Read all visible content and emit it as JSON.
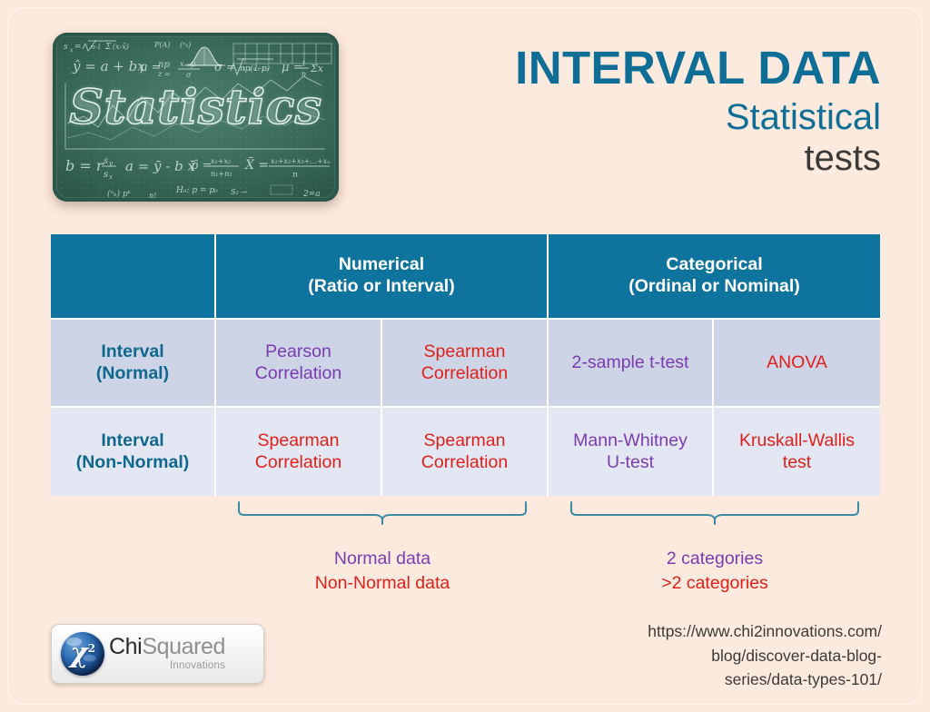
{
  "page": {
    "background_color": "#fdeade",
    "accent_teal": "#0f6e96",
    "accent_purple": "#7a3cb0",
    "accent_red": "#e0201a"
  },
  "header": {
    "title": "INTERVAL DATA",
    "subtitle_line1": "Statistical",
    "subtitle_line2": "tests"
  },
  "chalkboard": {
    "word": "Statistics",
    "formulas": [
      "s_x = √( 1/(n-1) Σ(x_i - x̄)² )",
      "ŷ = a + bx",
      "μ = np",
      "z = (x - μ)/σ",
      "σ = √(np(1-p))",
      "μ = (1/n)Σx_i",
      "b = r·s_y/s_x",
      "a = ȳ - b·x̄",
      "p̂ = (x₁+x₂)/(n₁+n₂)",
      "X̄ = (x₁+x₂+x₃+...+x_n)/n",
      "H₀: p = p₀"
    ]
  },
  "table": {
    "columns_header": [
      "",
      "Numerical\n(Ratio or Interval)",
      "Categorical\n(Ordinal or Nominal)"
    ],
    "header": {
      "blank": "",
      "numerical_line1": "Numerical",
      "numerical_line2": "(Ratio or Interval)",
      "categorical_line1": "Categorical",
      "categorical_line2": "(Ordinal or Nominal)"
    },
    "rows": [
      {
        "label_line1": "Interval",
        "label_line2": "(Normal)",
        "cells": [
          {
            "line1": "Pearson",
            "line2": "Correlation",
            "color": "purple"
          },
          {
            "line1": "Spearman",
            "line2": "Correlation",
            "color": "red"
          },
          {
            "line1": "2-sample t-test",
            "line2": "",
            "color": "purple"
          },
          {
            "line1": "ANOVA",
            "line2": "",
            "color": "red"
          }
        ]
      },
      {
        "label_line1": "Interval",
        "label_line2": "(Non-Normal)",
        "cells": [
          {
            "line1": "Spearman",
            "line2": "Correlation",
            "color": "red"
          },
          {
            "line1": "Spearman",
            "line2": "Correlation",
            "color": "red"
          },
          {
            "line1": "Mann-Whitney",
            "line2": "U-test",
            "color": "purple"
          },
          {
            "line1": "Kruskall-Wallis",
            "line2": "test",
            "color": "red"
          }
        ]
      }
    ]
  },
  "annotations": {
    "left": {
      "line1": "Normal data",
      "line2": "Non-Normal data"
    },
    "right": {
      "line1": "2 categories",
      "line2": ">2 categories"
    }
  },
  "url": {
    "line1": "https://www.chi2innovations.com/",
    "line2": "blog/discover-data-blog-",
    "line3": "series/data-types-101/"
  },
  "logo": {
    "symbol": "χ",
    "superscript": "2",
    "name_part1": "Chi",
    "name_part2": "Squared",
    "tagline": "Innovations"
  }
}
